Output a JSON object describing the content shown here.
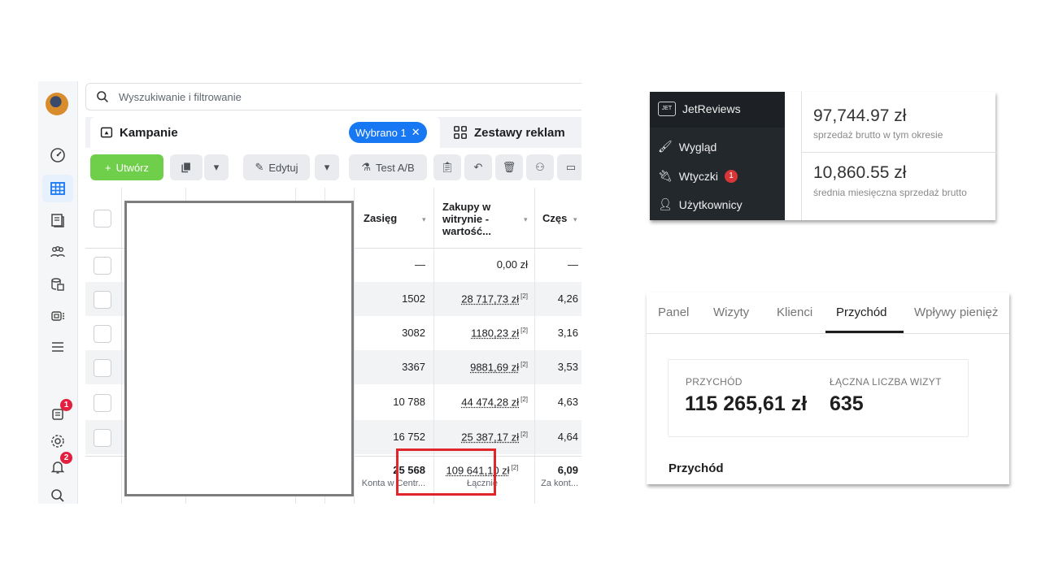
{
  "ads_manager": {
    "search_placeholder": "Wyszukiwanie i filtrowanie",
    "tab_campaigns": "Kampanie",
    "selected_chip": "Wybrano 1",
    "tab_adsets": "Zestawy reklam",
    "toolbar": {
      "create": "Utwórz",
      "edit": "Edytuj",
      "ab_test": "Test A/B"
    },
    "sidebar_badges": {
      "reports": "1",
      "notifications": "2"
    },
    "columns": {
      "reach": "Zasięg",
      "purchase_value": "Zakupy w witrynie - wartość...",
      "frequency": "Częs"
    },
    "rows": [
      {
        "reach": "—",
        "value": "0,00 zł",
        "freq": "—"
      },
      {
        "reach": "1502",
        "value": "28 717,73 zł",
        "freq": "4,26"
      },
      {
        "reach": "3082",
        "value": "1180,23 zł",
        "freq": "3,16"
      },
      {
        "reach": "3367",
        "value": "9881,69 zł",
        "freq": "3,53"
      },
      {
        "reach": "10 788",
        "value": "44 474,28 zł",
        "freq": "4,63"
      },
      {
        "reach": "16 752",
        "value": "25 387,17 zł",
        "freq": "4,64"
      }
    ],
    "sup_marker": "[2]",
    "total": {
      "reach": "25 568",
      "reach_note": "Konta w Centr...",
      "value": "109 641,10 zł",
      "value_note": "Łącznie",
      "freq": "6,09",
      "freq_note": "Za kont..."
    },
    "colors": {
      "accent": "#1877f2",
      "create": "#6fcf4a",
      "highlight": "#e0262b"
    }
  },
  "woocommerce": {
    "sidebar": {
      "plugin": "JetReviews",
      "appearance": "Wygląd",
      "plugins": "Wtyczki",
      "plugins_badge": "1",
      "users": "Użytkownicy"
    },
    "gross_sales": "97,744.97 zł",
    "gross_sales_label": "sprzedaż brutto w tym okresie",
    "monthly_avg": "10,860.55 zł",
    "monthly_avg_label": "średnia miesięczna sprzedaż brutto"
  },
  "analytics": {
    "tabs": [
      "Panel",
      "Wizyty",
      "Klienci",
      "Przychód",
      "Wpływy pienięż"
    ],
    "active_tab": "Przychód",
    "revenue_label": "PRZYCHÓD",
    "revenue_value": "115 265,61 zł",
    "visits_label": "ŁĄCZNA LICZBA WIZYT",
    "visits_value": "635",
    "section_title": "Przychód"
  }
}
